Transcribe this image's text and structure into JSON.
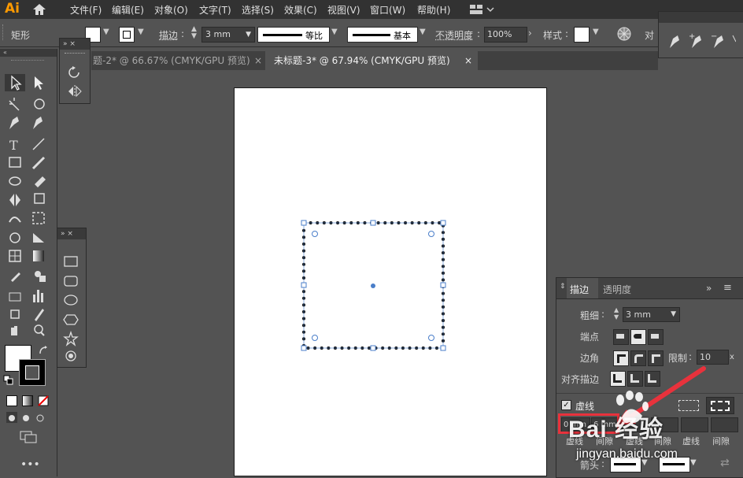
{
  "app": {
    "logo": "Ai"
  },
  "menu": [
    "文件(F)",
    "编辑(E)",
    "对象(O)",
    "文字(T)",
    "选择(S)",
    "效果(C)",
    "视图(V)",
    "窗口(W)",
    "帮助(H)"
  ],
  "control_bar": {
    "object_label": "矩形",
    "stroke_label": "描边",
    "stroke_weight": "3 mm",
    "profile_label": "等比",
    "brush_label": "基本",
    "opacity_label": "不透明度",
    "opacity_value": "100%",
    "style_label": "样式",
    "align_label": "对"
  },
  "tabs": [
    {
      "label": "题-2* @ 66.67% (CMYK/GPU 预览)",
      "close": "×",
      "active": false
    },
    {
      "label": "未标题-3* @ 67.94% (CMYK/GPU 预览)",
      "close": "×",
      "active": true
    }
  ],
  "stroke_panel": {
    "tab_stroke": "描边",
    "tab_transparency": "透明度",
    "weight_label": "粗细",
    "weight_value": "3 mm",
    "cap_label": "端点",
    "corner_label": "边角",
    "limit_label": "限制",
    "limit_value": "10",
    "limit_unit": "x",
    "align_label": "对齐描边",
    "dashed_label": "虚线",
    "dashed_checked": true,
    "dash_fields": [
      {
        "value": "0 mm",
        "label": "虚线"
      },
      {
        "value": "6 mm",
        "label": "间隙"
      },
      {
        "value": "",
        "label": "虚线"
      },
      {
        "value": "",
        "label": "间隙"
      },
      {
        "value": "",
        "label": "虚线"
      },
      {
        "value": "",
        "label": "间隙"
      }
    ],
    "arrow_label": "箭头"
  },
  "watermark": {
    "text": "Bai 经验",
    "url": "jingyan.baidu.com"
  },
  "colors": {
    "accent": "#ff9a00",
    "highlight_box": "#e8323c",
    "selection": "#4a7ec9"
  }
}
